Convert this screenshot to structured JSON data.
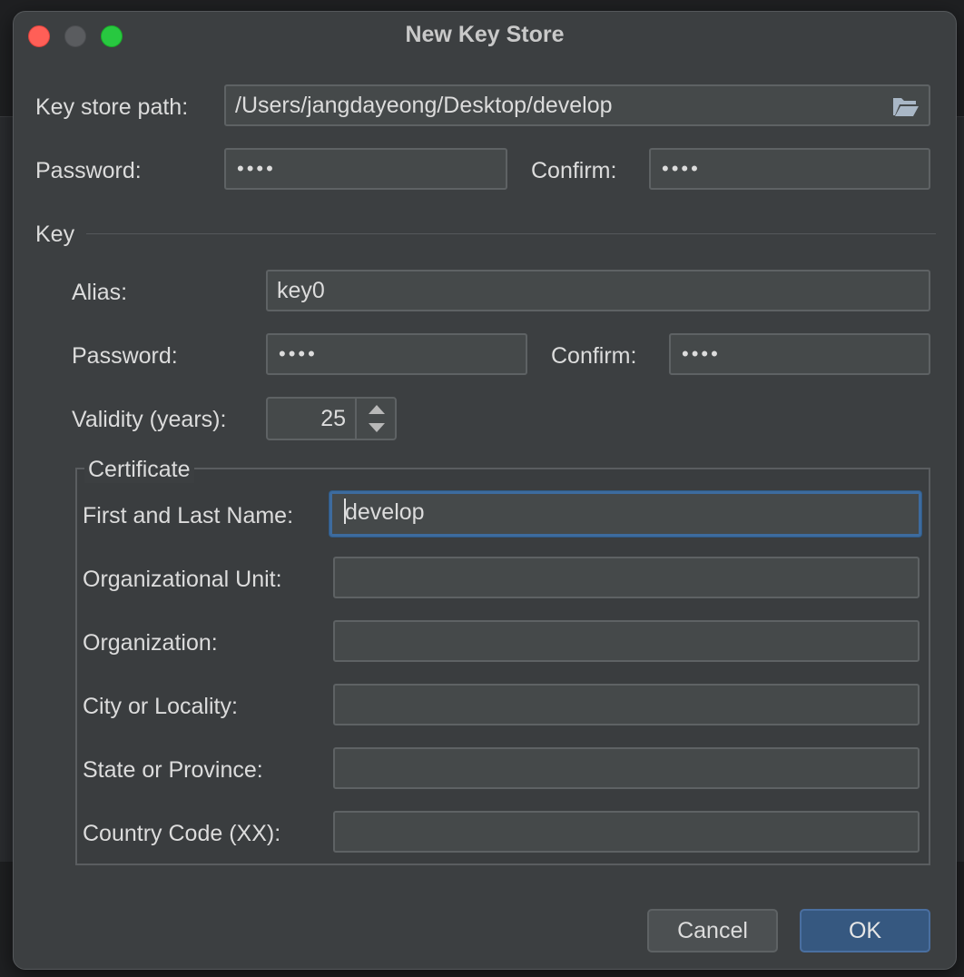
{
  "window": {
    "title": "New Key Store"
  },
  "keystore": {
    "path_label": "Key store path:",
    "path_value": "/Users/jangdayeong/Desktop/develop",
    "password_label": "Password:",
    "password_value": "••••",
    "confirm_label": "Confirm:",
    "confirm_value": "••••"
  },
  "key": {
    "section_label": "Key",
    "alias_label": "Alias:",
    "alias_value": "key0",
    "password_label": "Password:",
    "password_value": "••••",
    "confirm_label": "Confirm:",
    "confirm_value": "••••",
    "validity_label": "Validity (years):",
    "validity_value": "25"
  },
  "certificate": {
    "legend": "Certificate",
    "first_last_name_label": "First and Last Name:",
    "first_last_name_value": "develop",
    "org_unit_label": "Organizational Unit:",
    "org_unit_value": "",
    "organization_label": "Organization:",
    "organization_value": "",
    "city_label": "City or Locality:",
    "city_value": "",
    "state_label": "State or Province:",
    "state_value": "",
    "country_label": "Country Code (XX):",
    "country_value": ""
  },
  "buttons": {
    "cancel": "Cancel",
    "ok": "OK"
  },
  "icons": {
    "browse": "folder-open-icon",
    "spinner_up": "chevron-up-icon",
    "spinner_down": "chevron-down-icon"
  },
  "colors": {
    "dialog_bg": "#3c3f41",
    "field_bg": "#45494a",
    "focus_border": "#3d6b9e",
    "ok_button": "#365880"
  }
}
